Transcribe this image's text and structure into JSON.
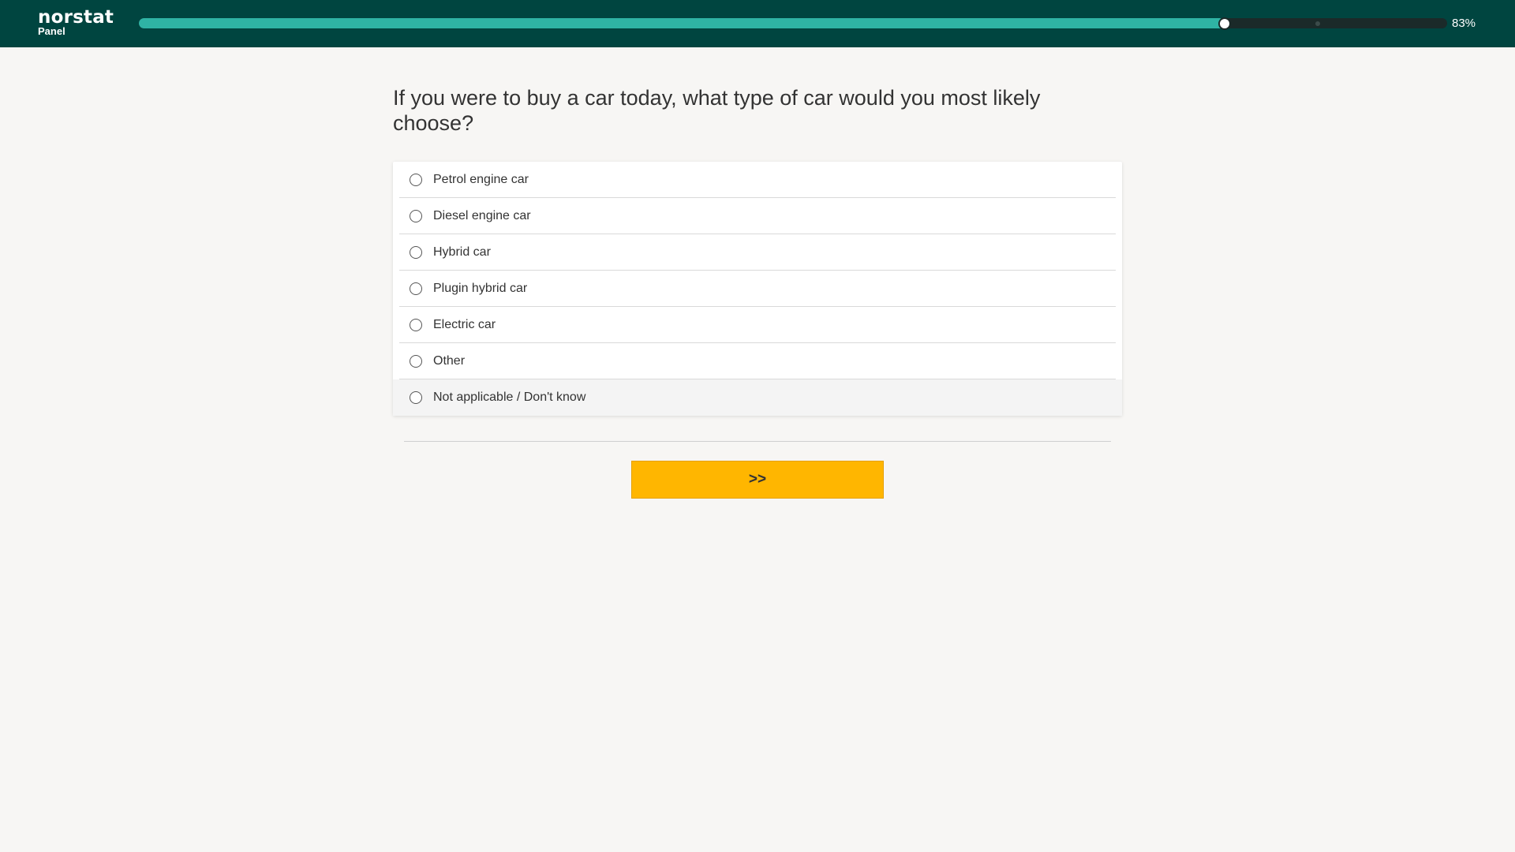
{
  "header": {
    "brand_name": "norstat",
    "brand_sub": "Panel",
    "progress_percent": 83,
    "progress_label": "83%"
  },
  "survey": {
    "question": "If you were to buy a car today, what type of car would you most likely choose?",
    "options": [
      {
        "label": "Petrol engine car"
      },
      {
        "label": "Diesel engine car"
      },
      {
        "label": "Hybrid car"
      },
      {
        "label": "Plugin hybrid car"
      },
      {
        "label": "Electric car"
      },
      {
        "label": "Other"
      },
      {
        "label": "Not applicable / Don't know"
      }
    ],
    "next_label": ">>"
  },
  "colors": {
    "header_bg": "#004540",
    "progress_fill": "#2fb3a4",
    "progress_track": "#1b2a29",
    "next_button": "#ffb600",
    "page_bg": "#f7f6f4"
  }
}
